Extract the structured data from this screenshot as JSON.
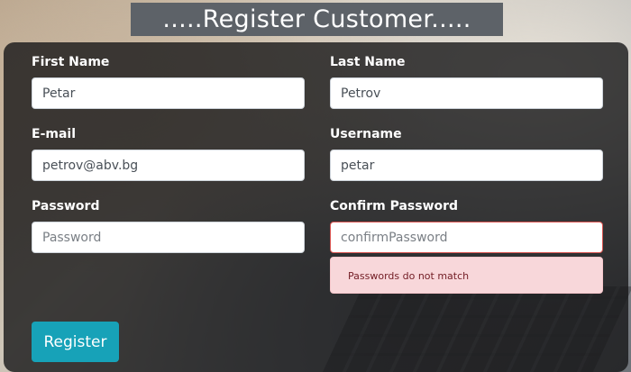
{
  "title": ".....Register Customer.....",
  "form": {
    "first_name": {
      "label": "First Name",
      "value": "Petar"
    },
    "last_name": {
      "label": "Last Name",
      "value": "Petrov"
    },
    "email": {
      "label": "E-mail",
      "value": "petrov@abv.bg"
    },
    "username": {
      "label": "Username",
      "value": "petar"
    },
    "password": {
      "label": "Password",
      "value": "",
      "placeholder": "Password"
    },
    "confirm_password": {
      "label": "Confirm Password",
      "value": "",
      "placeholder": "confirmPassword"
    },
    "error_message": "Passwords do not match",
    "submit_label": "Register"
  },
  "colors": {
    "button": "#17a2b8",
    "error_bg": "#f8d7da",
    "error_text": "#721c24",
    "invalid_border": "#d9534f"
  }
}
